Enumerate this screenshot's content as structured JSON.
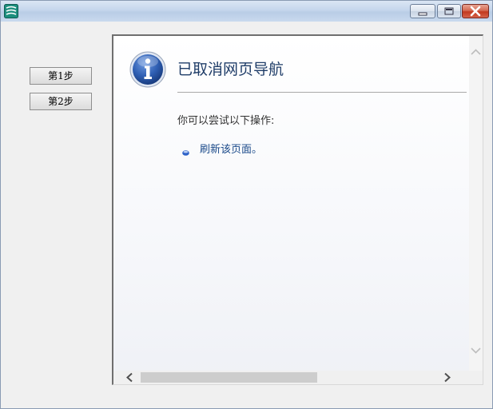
{
  "window": {
    "title": "",
    "icon": "app-logo-icon",
    "controls": [
      "minimize-icon",
      "maximize-icon",
      "close-icon"
    ]
  },
  "left_panel": {
    "buttons": [
      {
        "label": "第1步"
      },
      {
        "label": "第2步"
      }
    ]
  },
  "browser": {
    "icon": "info-icon",
    "title": "已取消网页导航",
    "try_label": "你可以尝试以下操作:",
    "actions": [
      {
        "label": "刷新该页面。",
        "icon": "bullet-icon"
      }
    ]
  },
  "colors": {
    "title_text": "#1f3d68",
    "link_text": "#1b4a8a",
    "info_icon": "#2f5fb3",
    "close_button": "#c2391f"
  }
}
